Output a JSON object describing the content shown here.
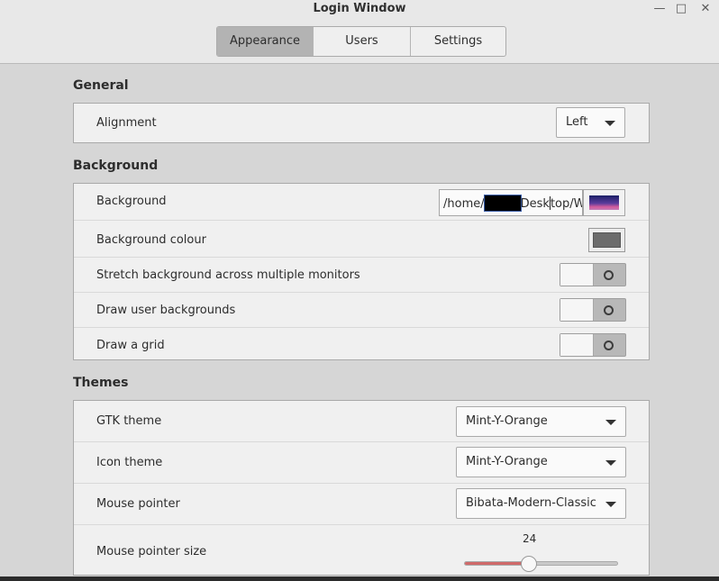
{
  "window": {
    "title": "Login Window",
    "controls": {
      "minimize": "—",
      "maximize": "□",
      "close": "✕"
    }
  },
  "tabs": [
    {
      "label": "Appearance",
      "active": true
    },
    {
      "label": "Users",
      "active": false
    },
    {
      "label": "Settings",
      "active": false
    }
  ],
  "general": {
    "title": "General",
    "alignment": {
      "label": "Alignment",
      "value": "Left"
    }
  },
  "background": {
    "title": "Background",
    "image": {
      "label": "Background",
      "path_prefix": "/home/",
      "path_suffix": "Desktop/W"
    },
    "colour": {
      "label": "Background colour",
      "value": "#6c6c6c"
    },
    "stretch": {
      "label": "Stretch background across multiple monitors",
      "on": false
    },
    "user_backgrounds": {
      "label": "Draw user backgrounds",
      "on": false
    },
    "grid": {
      "label": "Draw a grid",
      "on": false
    }
  },
  "themes": {
    "title": "Themes",
    "gtk": {
      "label": "GTK theme",
      "value": "Mint-Y-Orange"
    },
    "icon": {
      "label": "Icon theme",
      "value": "Mint-Y-Orange"
    },
    "pointer": {
      "label": "Mouse pointer",
      "value": "Bibata-Modern-Classic"
    },
    "pointer_size": {
      "label": "Mouse pointer size",
      "value": "24",
      "level": 0.42
    }
  },
  "colors": {
    "accent": "#d06a6a",
    "tab_active": "#b3b3b3"
  }
}
